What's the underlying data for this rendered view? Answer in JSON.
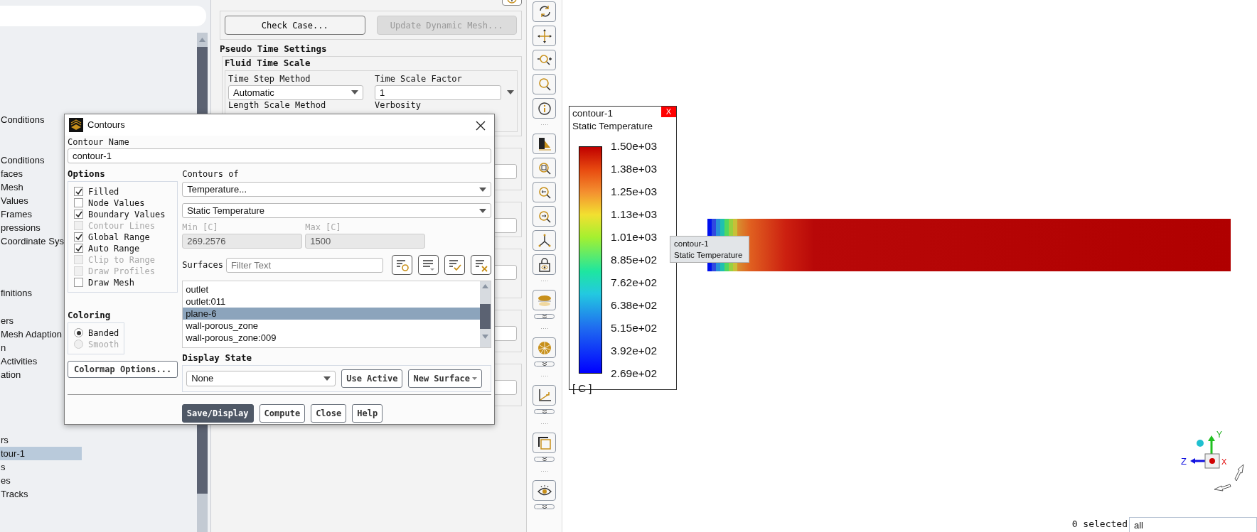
{
  "tree_groups": [
    [
      {
        "label": "Conditions",
        "selected": false
      }
    ],
    [
      {
        "label": "Conditions",
        "selected": false
      },
      {
        "label": "faces",
        "selected": false
      },
      {
        "label": "Mesh",
        "selected": false
      },
      {
        "label": "Values",
        "selected": false
      },
      {
        "label": "Frames",
        "selected": false
      },
      {
        "label": "pressions",
        "selected": false
      },
      {
        "label": "Coordinate Sys",
        "selected": false
      }
    ],
    [
      {
        "label": "finitions",
        "selected": false
      }
    ],
    [
      {
        "label": "ers",
        "selected": false
      },
      {
        "label": "Mesh Adaption",
        "selected": false
      },
      {
        "label": "n",
        "selected": false
      },
      {
        "label": "Activities",
        "selected": false
      },
      {
        "label": "ation",
        "selected": false
      }
    ],
    [
      {
        "label": "rs",
        "selected": false
      },
      {
        "label": "tour-1",
        "selected": true
      },
      {
        "label": "s",
        "selected": false
      },
      {
        "label": "es",
        "selected": false
      },
      {
        "label": "Tracks",
        "selected": false
      }
    ]
  ],
  "run_panel": {
    "buttons": [
      {
        "label": "Check Case...",
        "disabled": false
      },
      {
        "label": "Update Dynamic Mesh...",
        "disabled": true
      }
    ],
    "section_title": "Pseudo Time Settings",
    "group_title": "Fluid Time Scale",
    "time_step_method": {
      "label": "Time Step Method",
      "value": "Automatic"
    },
    "time_scale_factor": {
      "label": "Time Scale Factor",
      "value": "1"
    },
    "length_scale_method": {
      "label": "Length Scale Method"
    },
    "verbosity": {
      "label": "Verbosity"
    }
  },
  "contours_dialog": {
    "title": "Contours",
    "contour_name": {
      "label": "Contour Name",
      "value": "contour-1"
    },
    "options": {
      "title": "Options",
      "items": [
        {
          "label": "Filled",
          "checked": true,
          "disabled": false
        },
        {
          "label": "Node Values",
          "checked": false,
          "disabled": false
        },
        {
          "label": "Boundary Values",
          "checked": true,
          "disabled": false
        },
        {
          "label": "Contour Lines",
          "checked": false,
          "disabled": true
        },
        {
          "label": "Global Range",
          "checked": true,
          "disabled": false
        },
        {
          "label": "Auto Range",
          "checked": true,
          "disabled": false
        },
        {
          "label": "Clip to Range",
          "checked": false,
          "disabled": true
        },
        {
          "label": "Draw Profiles",
          "checked": false,
          "disabled": true
        },
        {
          "label": "Draw Mesh",
          "checked": false,
          "disabled": false
        }
      ]
    },
    "coloring": {
      "title": "Coloring",
      "items": [
        {
          "label": "Banded",
          "selected": true,
          "disabled": false
        },
        {
          "label": "Smooth",
          "selected": false,
          "disabled": true
        }
      ]
    },
    "colormap_button": "Colormap Options...",
    "contours_of": {
      "label": "Contours of",
      "quantity": "Temperature...",
      "field": "Static Temperature"
    },
    "min": {
      "label": "Min [C]",
      "value": "269.2576"
    },
    "max": {
      "label": "Max [C]",
      "value": "1500"
    },
    "surfaces": {
      "label": "Surfaces",
      "placeholder": "Filter Text",
      "items": [
        {
          "label": "outlet",
          "selected": false
        },
        {
          "label": "outlet:011",
          "selected": false
        },
        {
          "label": "plane-6",
          "selected": true
        },
        {
          "label": "wall-porous_zone",
          "selected": false
        },
        {
          "label": "wall-porous_zone:009",
          "selected": false
        }
      ]
    },
    "display_state": {
      "title": "Display State",
      "value": "None",
      "buttons": [
        {
          "label": "Use Active",
          "kind": "plain"
        },
        {
          "label": "New Surface",
          "kind": "menu"
        }
      ]
    },
    "buttons": [
      {
        "label": "Save/Display",
        "primary": true
      },
      {
        "label": "Compute",
        "primary": false
      },
      {
        "label": "Close",
        "primary": false
      },
      {
        "label": "Help",
        "primary": false
      }
    ]
  },
  "legend": {
    "title": "contour-1",
    "subtitle": "Static Temperature",
    "close_label": "X",
    "ticks": [
      "1.50e+03",
      "1.38e+03",
      "1.25e+03",
      "1.13e+03",
      "1.01e+03",
      "8.85e+02",
      "7.62e+02",
      "6.38e+02",
      "5.15e+02",
      "3.92e+02",
      "2.69e+02"
    ],
    "unit": "[ C ]"
  },
  "tooltip": {
    "title": "contour-1",
    "subtitle": "Static Temperature"
  },
  "axis_triad": {
    "x_label": "X",
    "y_label": "Y",
    "z_label": "Z"
  },
  "status_bar": {
    "selection": "0 selected",
    "filter": "all"
  }
}
